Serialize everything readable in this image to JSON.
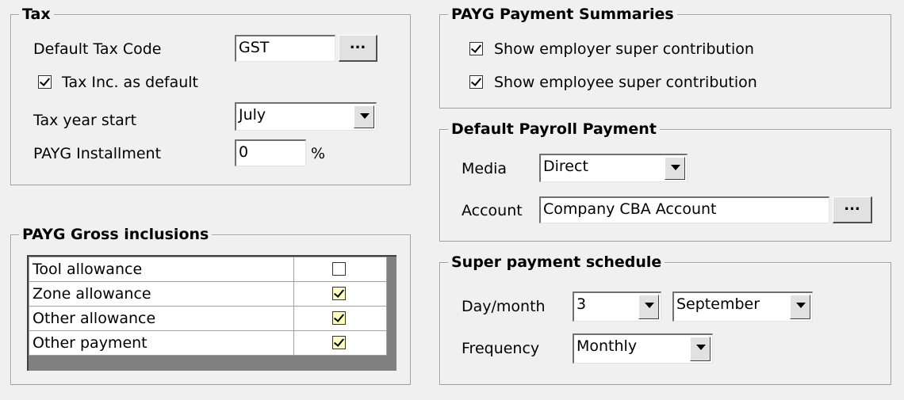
{
  "tax": {
    "title": "Tax",
    "default_tax_code_label": "Default Tax Code",
    "default_tax_code_value": "GST",
    "browse_label": "...",
    "tax_inc_label": "Tax Inc. as default",
    "tax_inc_checked": true,
    "tax_year_start_label": "Tax year start",
    "tax_year_start_value": "July",
    "payg_installment_label": "PAYG Installment",
    "payg_installment_value": "0",
    "percent_sign": "%"
  },
  "gross_inclusions": {
    "title": "PAYG Gross inclusions",
    "rows": [
      {
        "label": "Tool allowance",
        "checked": false
      },
      {
        "label": "Zone allowance",
        "checked": true
      },
      {
        "label": "Other allowance",
        "checked": true
      },
      {
        "label": "Other payment",
        "checked": true
      }
    ]
  },
  "payment_summaries": {
    "title": "PAYG Payment Summaries",
    "employer_label": "Show employer super contribution",
    "employer_checked": true,
    "employee_label": "Show employee super contribution",
    "employee_checked": true
  },
  "payroll_payment": {
    "title": "Default Payroll Payment",
    "media_label": "Media",
    "media_value": "Direct",
    "account_label": "Account",
    "account_value": "Company CBA Account",
    "browse_label": "..."
  },
  "super_schedule": {
    "title": "Super payment schedule",
    "day_month_label": "Day/month",
    "day_value": "3",
    "month_value": "September",
    "frequency_label": "Frequency",
    "frequency_value": "Monthly"
  }
}
